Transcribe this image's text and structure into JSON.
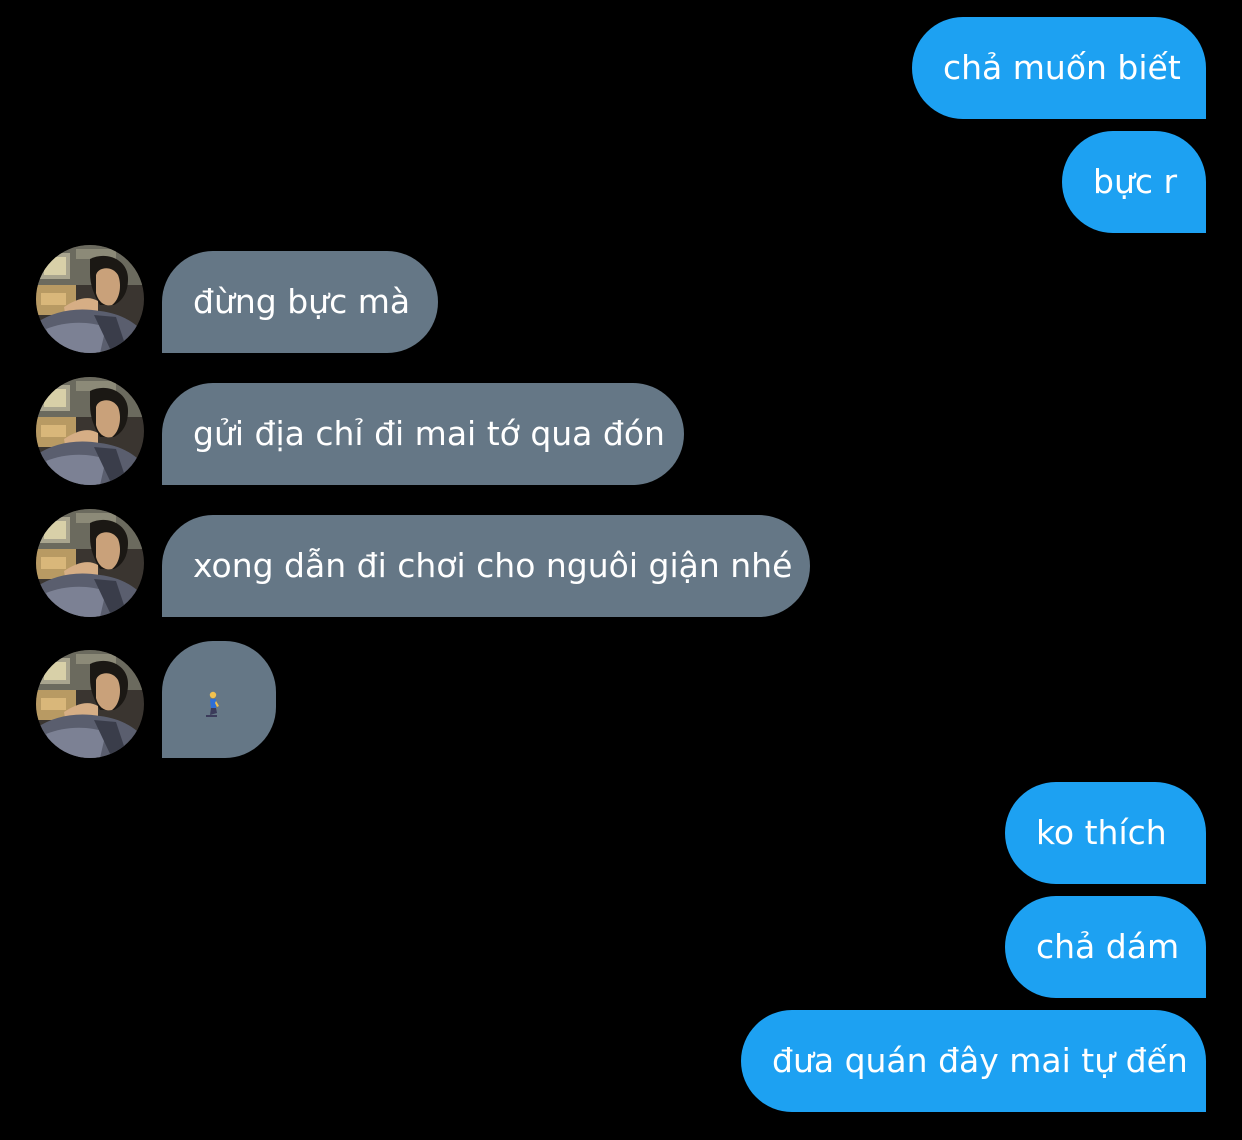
{
  "conversation": {
    "messages": [
      {
        "sender": "self",
        "text": "chả muốn biết"
      },
      {
        "sender": "self",
        "text": "bực r"
      },
      {
        "sender": "other",
        "text": "đừng bực mà"
      },
      {
        "sender": "other",
        "text": "gửi địa chỉ đi mai tớ qua đón"
      },
      {
        "sender": "other",
        "text": "xong dẫn đi chơi cho nguôi giận nhé"
      },
      {
        "sender": "other",
        "emoji": "person-kneeling"
      },
      {
        "sender": "self",
        "text": "ko thích"
      },
      {
        "sender": "self",
        "text": "chả dám"
      },
      {
        "sender": "self",
        "text": "đưa quán đây mai tự đến"
      }
    ]
  },
  "colors": {
    "background": "#000000",
    "sent_bubble": "#1da1f2",
    "received_bubble": "#657786",
    "text": "#ffffff"
  }
}
